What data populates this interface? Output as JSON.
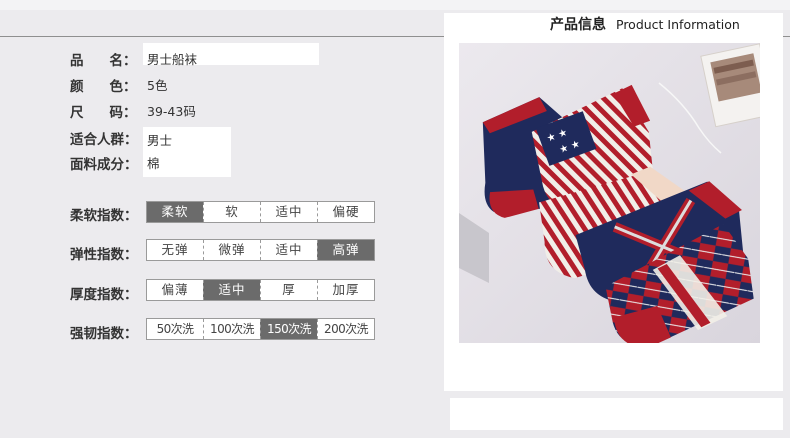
{
  "header": {
    "title_zh": "产品信息",
    "title_en": "Product Information"
  },
  "info": [
    {
      "key": "name",
      "label": "品  名：",
      "value": "男士船袜"
    },
    {
      "key": "color",
      "label": "颜  色：",
      "value": "5色"
    },
    {
      "key": "size",
      "label": "尺  码：",
      "value": "39-43码"
    },
    {
      "key": "audience",
      "label": "适合人群：",
      "value": "男士"
    },
    {
      "key": "fabric",
      "label": "面料成分：",
      "value": "棉"
    }
  ],
  "scales": [
    {
      "key": "softness",
      "label": "柔软指数：",
      "options": [
        "柔软",
        "软",
        "适中",
        "偏硬"
      ],
      "selected": 0
    },
    {
      "key": "elasticity",
      "label": "弹性指数：",
      "options": [
        "无弹",
        "微弹",
        "适中",
        "高弹"
      ],
      "selected": 3
    },
    {
      "key": "thickness",
      "label": "厚度指数：",
      "options": [
        "偏薄",
        "适中",
        "厚",
        "加厚"
      ],
      "selected": 1
    },
    {
      "key": "durability",
      "label": "强韧指数：",
      "options": [
        "50次洗",
        "100次洗",
        "150次洗",
        "200次洗"
      ],
      "selected": 2
    }
  ],
  "colors": {
    "background": "#ecebee",
    "selected": "#6b6b6b",
    "navy": "#1f2a5c",
    "red": "#b21e2b"
  }
}
